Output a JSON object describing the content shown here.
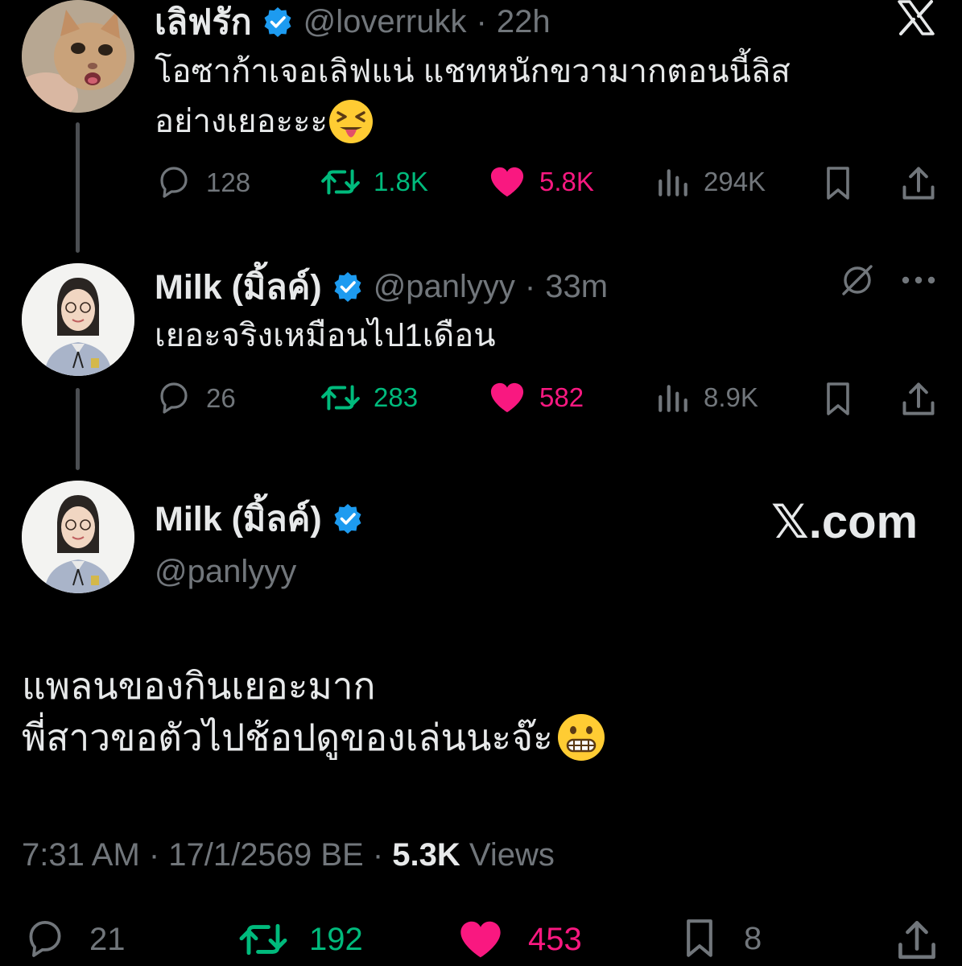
{
  "tweets": [
    {
      "name": "เลิฟรัก",
      "handle": "@loverrukk",
      "time": "22h",
      "text_lines": [
        "โอซาก้าเจอเลิฟแน่ แชทหนักขวามากตอนนี้ลิส",
        "อย่างเยอะะะ"
      ],
      "emoji": "tongue-out-squint-emoji",
      "replies": "128",
      "retweets": "1.8K",
      "likes": "5.8K",
      "views": "294K"
    },
    {
      "name": "Milk (มิ้ลค์)",
      "handle": "@panlyyy",
      "time": "33m",
      "text_lines": [
        "เยอะจริงเหมือนไป1เดือน"
      ],
      "replies": "26",
      "retweets": "283",
      "likes": "582",
      "views": "8.9K"
    }
  ],
  "main": {
    "name": "Milk (มิ้ลค์)",
    "handle": "@panlyyy",
    "watermark": "𝕏.com",
    "text_lines": [
      "แพลนของกินเยอะมาก",
      "พี่สาวขอตัวไปช้อปดูของเล่นนะจ๊ะ"
    ],
    "emoji": "grimacing-emoji",
    "timestamp": "7:31 AM · 17/1/2569 BE · ",
    "views_count": "5.3K",
    "views_label": " Views",
    "replies": "21",
    "retweets": "192",
    "likes": "453",
    "bookmarks": "8"
  },
  "separator": "·",
  "colors": {
    "background": "#000000",
    "text": "#e7e9ea",
    "muted": "#71767b",
    "retweet": "#00ba7c",
    "like": "#f91880",
    "verified": "#1d9bf0"
  }
}
